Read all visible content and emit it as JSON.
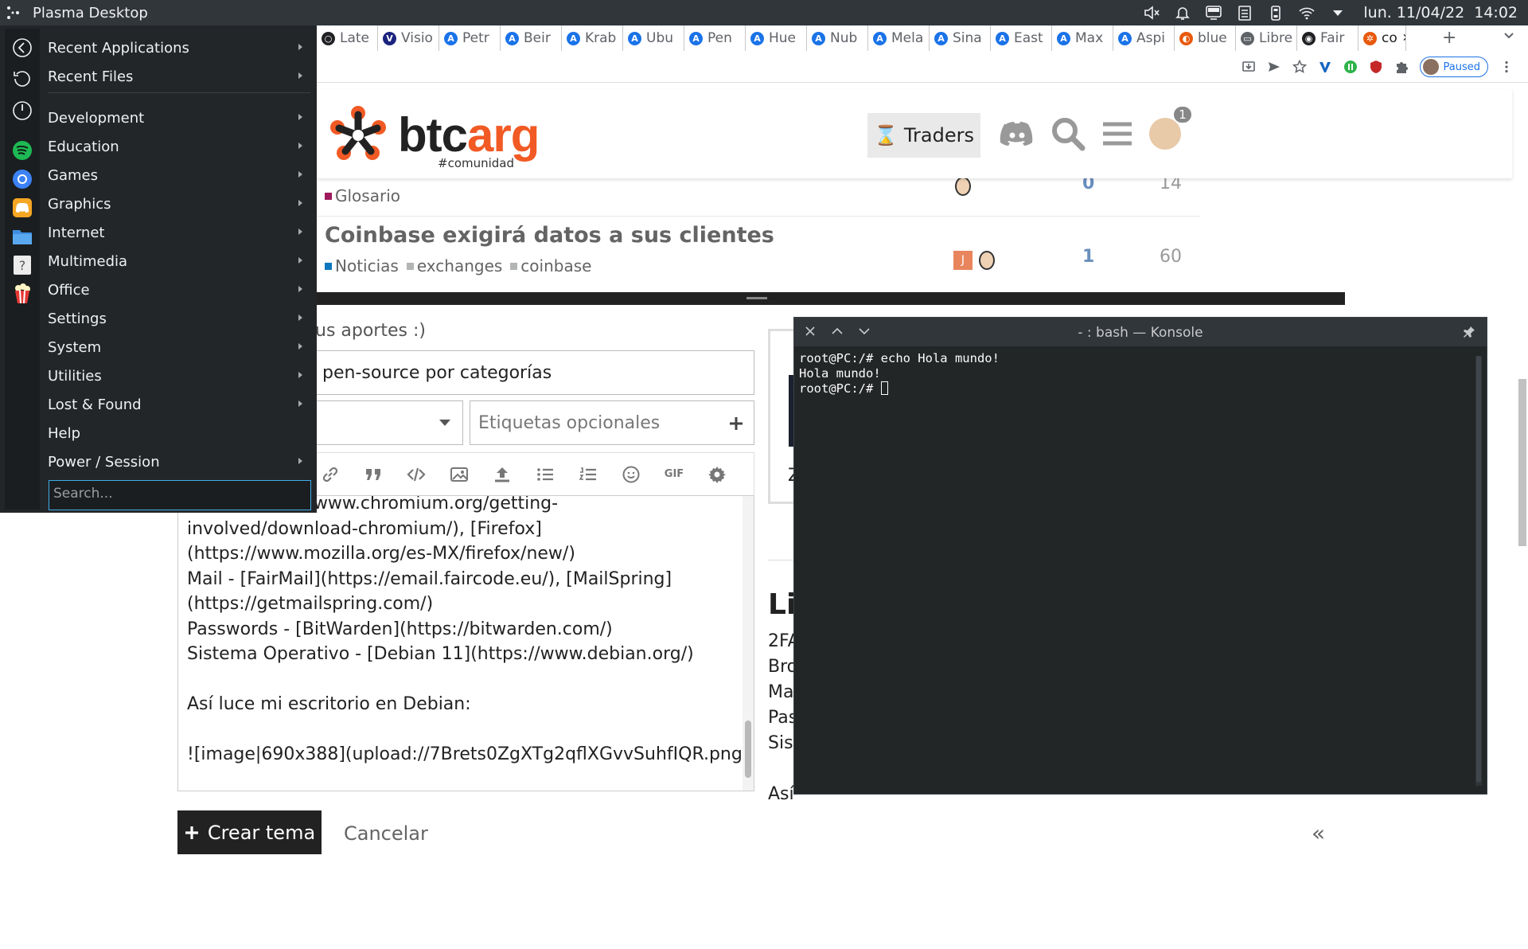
{
  "panel": {
    "title": "Plasma Desktop",
    "clock": "lun. 11/04/22  14:02",
    "tray_icons": [
      "volume-muted-icon",
      "notifications-icon",
      "display-icon",
      "clipboard-icon",
      "battery-icon",
      "wifi-icon",
      "expand-tray-icon"
    ]
  },
  "kicker": {
    "items": [
      {
        "label": "Recent Applications",
        "arrow": true
      },
      {
        "label": "Recent Files",
        "arrow": true
      },
      {
        "label": "Development",
        "arrow": true
      },
      {
        "label": "Education",
        "arrow": true
      },
      {
        "label": "Games",
        "arrow": true
      },
      {
        "label": "Graphics",
        "arrow": true
      },
      {
        "label": "Internet",
        "arrow": true
      },
      {
        "label": "Multimedia",
        "arrow": true
      },
      {
        "label": "Office",
        "arrow": true
      },
      {
        "label": "Settings",
        "arrow": true
      },
      {
        "label": "System",
        "arrow": true
      },
      {
        "label": "Utilities",
        "arrow": true
      },
      {
        "label": "Lost & Found",
        "arrow": true
      },
      {
        "label": "Help",
        "arrow": false
      },
      {
        "label": "Power / Session",
        "arrow": true
      }
    ],
    "search_placeholder": "Search...",
    "favorites": [
      "back-icon",
      "history-icon",
      "power-icon",
      "spotify-icon",
      "chromium-icon",
      "discord-icon",
      "files-icon",
      "help-icon",
      "popcorn-icon"
    ]
  },
  "browser": {
    "tabs": [
      {
        "label": "Late",
        "fav": "#202124",
        "glyph": "○"
      },
      {
        "label": "Visio",
        "fav": "#1a237e",
        "glyph": "V"
      },
      {
        "label": "Petr",
        "fav": "#1a73e8",
        "glyph": "A"
      },
      {
        "label": "Beir",
        "fav": "#1a73e8",
        "glyph": "A"
      },
      {
        "label": "Krab",
        "fav": "#1a73e8",
        "glyph": "A"
      },
      {
        "label": "Ubu",
        "fav": "#1a73e8",
        "glyph": "A"
      },
      {
        "label": "Pen",
        "fav": "#1a73e8",
        "glyph": "A"
      },
      {
        "label": "Hue",
        "fav": "#1a73e8",
        "glyph": "A"
      },
      {
        "label": "Nub",
        "fav": "#1a73e8",
        "glyph": "A"
      },
      {
        "label": "Mela",
        "fav": "#1a73e8",
        "glyph": "A"
      },
      {
        "label": "Sina",
        "fav": "#1a73e8",
        "glyph": "A"
      },
      {
        "label": "East",
        "fav": "#1a73e8",
        "glyph": "A"
      },
      {
        "label": "Max",
        "fav": "#1a73e8",
        "glyph": "A"
      },
      {
        "label": "Aspi",
        "fav": "#1a73e8",
        "glyph": "A"
      },
      {
        "label": "blue",
        "fav": "#e8590c",
        "glyph": "◐"
      },
      {
        "label": "Libre",
        "fav": "#5f6368",
        "glyph": "▭"
      },
      {
        "label": "Fair",
        "fav": "#202124",
        "glyph": "◉"
      },
      {
        "label": "co",
        "fav": "#e8590c",
        "glyph": "✲",
        "active": true
      }
    ],
    "new_tab": "+",
    "close_tab": "✕",
    "paused_label": "Paused",
    "toolbar_icons": [
      "install-icon",
      "send-icon",
      "star-icon",
      "extension-v-icon",
      "extension-green-icon",
      "extension-red-icon",
      "puzzle-icon"
    ]
  },
  "site": {
    "logo_word": "btcarg",
    "logo_tag": "#comunidad",
    "traders": "Traders",
    "badge": "1"
  },
  "topics": [
    {
      "title": "",
      "cats": [
        {
          "name": "Glosario",
          "color": "#9e1a5c"
        }
      ],
      "replies": "0",
      "views": "14"
    },
    {
      "title": "Coinbase exigirá datos a sus clientes",
      "cats": [
        {
          "name": "Noticias",
          "color": "#0e76bd"
        },
        {
          "name": "exchanges",
          "color": "#b3b5b4"
        },
        {
          "name": "coinbase",
          "color": "#b3b5b4"
        }
      ],
      "replies": "1",
      "views": "60",
      "poster": "J"
    }
  ],
  "composer": {
    "hint": "us aportes :)",
    "title_value": "pen-source por categorías",
    "tags_placeholder": "Etiquetas opcionales",
    "body": "mium](https://www.chromium.org/getting-\ninvolved/download-chromium/), [Firefox]\n(https://www.mozilla.org/es-MX/firefox/new/)\nMail - [FairMail](https://email.faircode.eu/), [MailSpring]\n(https://getmailspring.com/)\nPasswords - [BitWarden](https://bitwarden.com/)\nSistema Operativo - [Debian 11](https://www.debian.org/)\n\nAsí luce mi escritorio en Debian:\n\n![image|690x388](upload://7Brets0ZgXTg2qflXGvvSuhfIQR.png)",
    "create_label": "Crear tema",
    "cancel_label": "Cancelar",
    "gif_label": "GIF"
  },
  "preview": {
    "heading": "Lis",
    "lines": [
      "2FA",
      "Bro",
      "Ma",
      "Pas",
      "Sist",
      "",
      "Así"
    ],
    "partial": "Z"
  },
  "konsole": {
    "title": "- : bash — Konsole",
    "lines": [
      "root@PC:/# echo Hola mundo!",
      "Hola mundo!",
      "root@PC:/# "
    ]
  }
}
